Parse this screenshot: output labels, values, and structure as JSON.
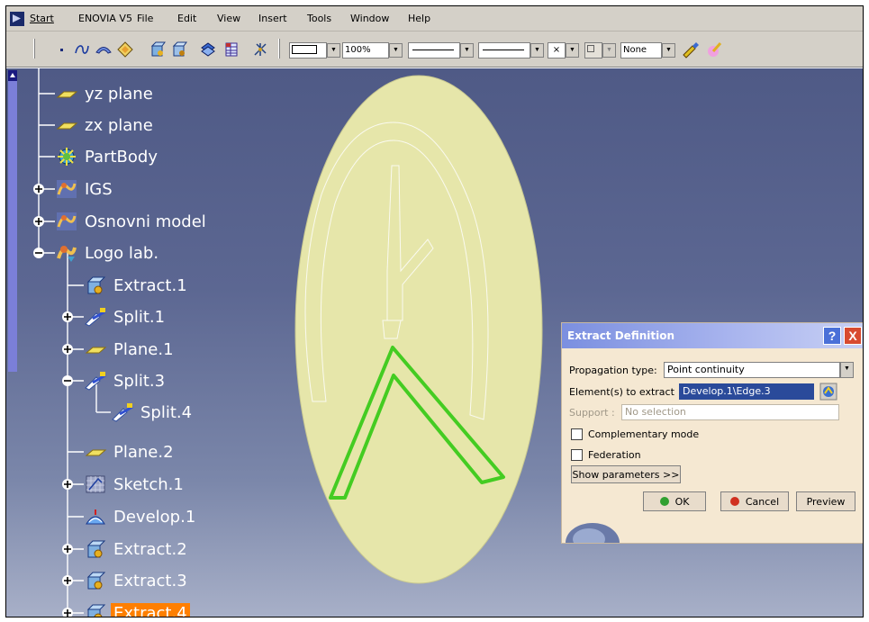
{
  "menu": {
    "items": [
      "Start",
      "ENOVIA V5",
      "File",
      "Edit",
      "View",
      "Insert",
      "Tools",
      "Window",
      "Help"
    ]
  },
  "toolbar": {
    "color_value": "",
    "transparency_value": "100%",
    "linetype_value": "",
    "thickness_value": "",
    "point_value": "×",
    "layer_value": "None"
  },
  "tree": {
    "nodes": [
      {
        "label": "yz plane",
        "icon": "plane-icon"
      },
      {
        "label": "zx plane",
        "icon": "plane-icon"
      },
      {
        "label": "PartBody",
        "icon": "partbody-icon"
      },
      {
        "label": "IGS",
        "icon": "geometrical-set-icon"
      },
      {
        "label": "Osnovni model",
        "icon": "geometrical-set-icon"
      },
      {
        "label": "Logo lab.",
        "icon": "geometrical-set-icon"
      },
      {
        "label": "Extract.1",
        "icon": "extract-icon"
      },
      {
        "label": "Split.1",
        "icon": "split-icon"
      },
      {
        "label": "Plane.1",
        "icon": "plane-icon"
      },
      {
        "label": "Split.3",
        "icon": "split-icon"
      },
      {
        "label": "Split.4",
        "icon": "split-icon"
      },
      {
        "label": "Plane.2",
        "icon": "plane-icon"
      },
      {
        "label": "Sketch.1",
        "icon": "sketch-icon"
      },
      {
        "label": "Develop.1",
        "icon": "develop-icon"
      },
      {
        "label": "Extract.2",
        "icon": "extract-icon"
      },
      {
        "label": "Extract.3",
        "icon": "extract-icon"
      },
      {
        "label": "Extract.4",
        "icon": "extract-icon",
        "selected": true
      }
    ]
  },
  "dialog": {
    "title": "Extract Definition",
    "help_label": "?",
    "close_label": "X",
    "propagation_label": "Propagation type:",
    "propagation_value": "Point continuity",
    "elements_label": "Element(s) to extract",
    "elements_value": "Develop.1\\Edge.3",
    "support_label": "Support :",
    "support_value": "No selection",
    "complementary_label": "Complementary mode",
    "federation_label": "Federation",
    "show_params_label": "Show parameters >>",
    "ok_label": "OK",
    "cancel_label": "Cancel",
    "preview_label": "Preview"
  },
  "colors": {
    "viewport_top": "#4f5a86",
    "part_surface": "#e6e6aa",
    "extract_highlight": "#44cc22",
    "selected_node": "#ff7f00"
  }
}
